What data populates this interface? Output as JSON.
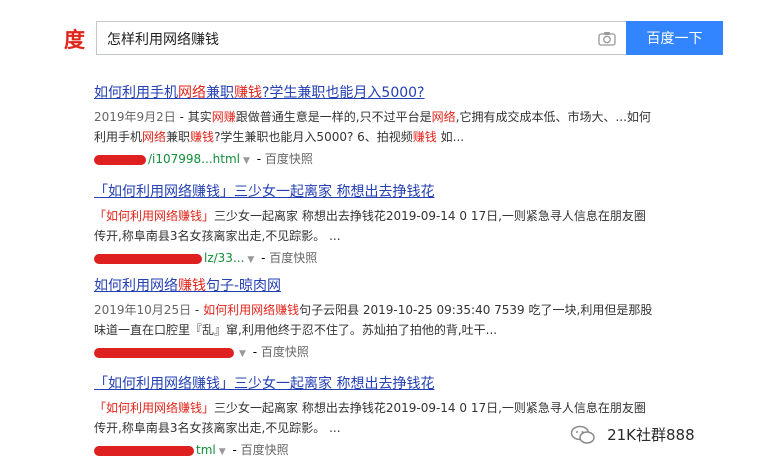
{
  "header": {
    "logo_text": "度",
    "search_query": "怎样利用网络赚钱",
    "search_button_label": "百度一下"
  },
  "results": [
    {
      "title_parts": [
        {
          "text": "如何利用手机",
          "hl": false
        },
        {
          "text": "网络",
          "hl": true
        },
        {
          "text": "兼职",
          "hl": false
        },
        {
          "text": "赚钱",
          "hl": true
        },
        {
          "text": "?学生兼职也能月入5000?",
          "hl": false
        }
      ],
      "date": "2019年9月2日",
      "abstract_parts": [
        {
          "text": " - 其实",
          "hl": false
        },
        {
          "text": "网赚",
          "hl": true
        },
        {
          "text": "跟做普通生意是一样的,只不过平台是",
          "hl": false
        },
        {
          "text": "网络",
          "hl": true
        },
        {
          "text": ",它拥有成交成本低、市场大、...如何利用手机",
          "hl": false
        },
        {
          "text": "网络",
          "hl": true
        },
        {
          "text": "兼职",
          "hl": false
        },
        {
          "text": "赚钱",
          "hl": true
        },
        {
          "text": "?学生兼职也能月入5000? 6、拍视频",
          "hl": false
        },
        {
          "text": "赚钱",
          "hl": true
        },
        {
          "text": " 如...",
          "hl": false
        }
      ],
      "url": "/i107998...html",
      "snapshot_label": "百度快照"
    },
    {
      "title_parts": [
        {
          "text": "「如何利用网络赚钱」三少女一起离家 称想出去挣钱花",
          "hl": false
        }
      ],
      "date": "",
      "abstract_parts": [
        {
          "text": "「如何利用网络赚钱」",
          "hl": true
        },
        {
          "text": "三少女一起离家 称想出去挣钱花2019-09-14 0 17日,一则紧急寻人信息在朋友圈传开,称阜南县3名女孩离家出走,不见踪影。 ...",
          "hl": false
        }
      ],
      "url": "lz/33...",
      "snapshot_label": "百度快照"
    },
    {
      "title_parts": [
        {
          "text": "如何利用网络",
          "hl": false
        },
        {
          "text": "赚钱",
          "hl": true
        },
        {
          "text": "句子-晾肉网",
          "hl": false
        }
      ],
      "date": "2019年10月25日",
      "abstract_parts": [
        {
          "text": " - ",
          "hl": false
        },
        {
          "text": "如何利用网络赚钱",
          "hl": true
        },
        {
          "text": "句子云阳县 2019-10-25 09:35:40 7539 吃了一块,利用但是那股味道一直在口腔里『乱』窜,利用他终于忍不住了。苏灿拍了拍他的背,吐干...",
          "hl": false
        }
      ],
      "url": "",
      "snapshot_label": "百度快照"
    },
    {
      "title_parts": [
        {
          "text": "「如何利用网络赚钱」三少女一起离家 称想出去挣钱花",
          "hl": false
        }
      ],
      "date": "",
      "abstract_parts": [
        {
          "text": "「如何利用网络赚钱」",
          "hl": true
        },
        {
          "text": "三少女一起离家 称想出去挣钱花2019-09-14 0 17日,一则紧急寻人信息在朋友圈传开,称阜南县3名女孩离家出走,不见踪影。 ...",
          "hl": false
        }
      ],
      "url": "tml",
      "snapshot_label": "百度快照"
    }
  ],
  "watermark": {
    "text": "21K社群888"
  },
  "colors": {
    "brand": "#3385ff",
    "logo": "#e1251b",
    "title": "#2440b3",
    "highlight": "#e1251b",
    "url": "#118e3a"
  }
}
